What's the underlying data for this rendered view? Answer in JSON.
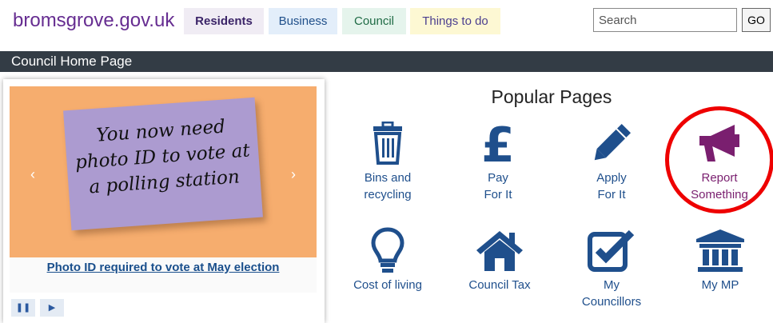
{
  "header": {
    "site_name": "bromsgrove.gov.uk",
    "tabs": [
      "Residents",
      "Business",
      "Council",
      "Things to do"
    ],
    "search_placeholder": "Search",
    "go_label": "GO"
  },
  "title_bar": "Council Home Page",
  "carousel": {
    "note_lines": [
      "You now need",
      "photo ID to vote at",
      "a polling station"
    ],
    "caption": "Photo ID required to vote at May election",
    "prev_glyph": "‹",
    "next_glyph": "›",
    "pause_glyph": "❚❚",
    "play_glyph": "▶"
  },
  "popular": {
    "title": "Popular Pages",
    "items": [
      {
        "line1": "Bins and",
        "line2": "recycling",
        "icon": "bin-icon"
      },
      {
        "line1": "Pay",
        "line2": "For It",
        "icon": "pound-icon"
      },
      {
        "line1": "Apply",
        "line2": "For It",
        "icon": "pencil-icon"
      },
      {
        "line1": "Report",
        "line2": "Something",
        "icon": "megaphone-icon"
      },
      {
        "line1": "Cost of living",
        "line2": "",
        "icon": "lightbulb-icon"
      },
      {
        "line1": "Council Tax",
        "line2": "",
        "icon": "house-icon"
      },
      {
        "line1": "My",
        "line2": "Councillors",
        "icon": "checkbox-icon"
      },
      {
        "line1": "My MP",
        "line2": "",
        "icon": "building-icon"
      }
    ]
  },
  "colors": {
    "accent_blue": "#1f4f8c",
    "report_purple": "#7a1f6f",
    "highlight_ring": "#e00000"
  }
}
